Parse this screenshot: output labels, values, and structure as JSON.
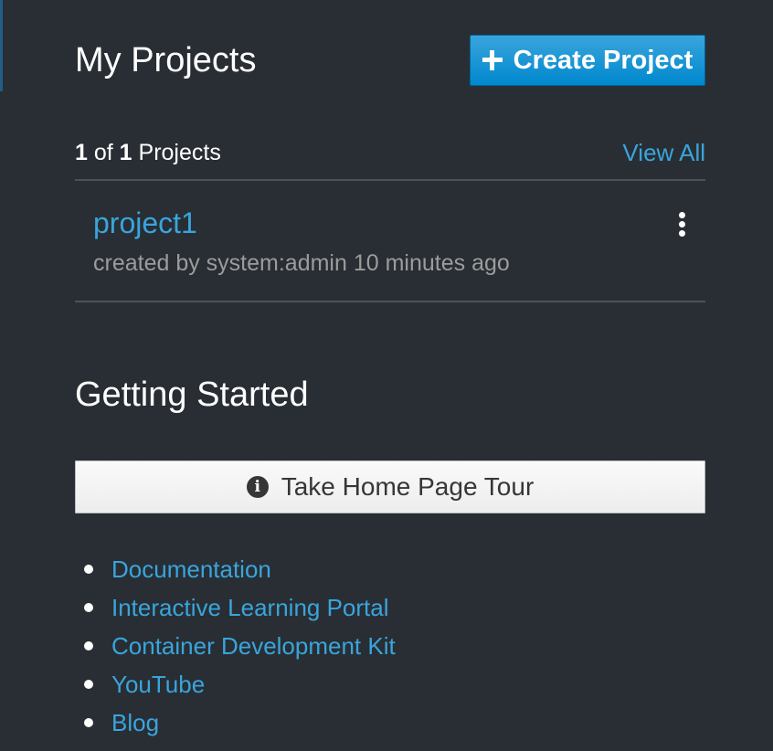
{
  "my_projects": {
    "title": "My Projects",
    "create_button_label": "Create Project",
    "count_current": "1",
    "count_of": "of",
    "count_total": "1",
    "count_suffix": "Projects",
    "view_all_label": "View All",
    "projects": [
      {
        "name": "project1",
        "meta": "created by system:admin 10 minutes ago"
      }
    ]
  },
  "getting_started": {
    "title": "Getting Started",
    "tour_button_label": "Take Home Page Tour",
    "links": [
      "Documentation",
      "Interactive Learning Portal",
      "Container Development Kit",
      "YouTube",
      "Blog"
    ]
  },
  "icons": {
    "create_button_icon": "plus-icon",
    "tour_button_icon": "info-circle-icon",
    "project_actions_icon": "kebab-menu-icon"
  },
  "colors": {
    "background": "#292e34",
    "link": "#39a5dc",
    "primary_button": "#0088ce",
    "divider": "#4d5258",
    "muted_text": "#9c9c9c"
  }
}
